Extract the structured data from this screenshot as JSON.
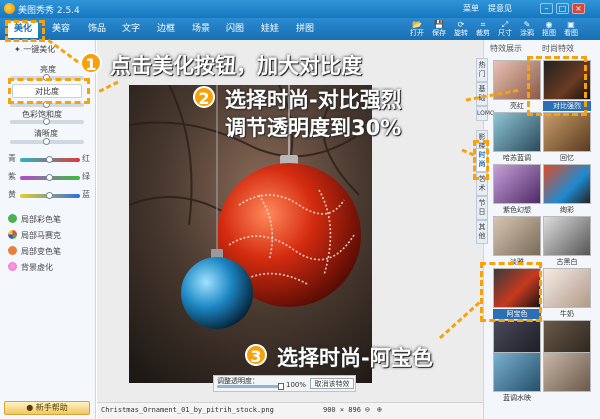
{
  "app": {
    "title": "美图秀秀 2.5.4"
  },
  "titlebar": {
    "menu": "菜单",
    "feedback": "提意见"
  },
  "nav": {
    "tabs": [
      "美化",
      "美容",
      "饰品",
      "文字",
      "边框",
      "场景",
      "闪图",
      "娃娃",
      "拼图"
    ],
    "tools": [
      {
        "icon": "open-icon",
        "label": "打开"
      },
      {
        "icon": "save-icon",
        "label": "保存"
      },
      {
        "icon": "rotate-icon",
        "label": "旋转"
      },
      {
        "icon": "crop-icon",
        "label": "裁剪"
      },
      {
        "icon": "size-icon",
        "label": "尺寸"
      },
      {
        "icon": "doodle-icon",
        "label": "涂鸦"
      },
      {
        "icon": "camera-icon",
        "label": "抠图"
      },
      {
        "icon": "view-icon",
        "label": "看图"
      }
    ]
  },
  "left": {
    "one_click": "一键美化",
    "brightness": "亮度",
    "contrast": "对比度",
    "saturation": "色彩饱和度",
    "sharpness": "清晰度",
    "color_rows": [
      {
        "left": "青",
        "right": "红"
      },
      {
        "left": "紫",
        "right": "绿"
      },
      {
        "left": "黄",
        "right": "蓝"
      }
    ],
    "tools": [
      "局部彩色笔",
      "局部马赛克",
      "局部变色笔",
      "背景虚化"
    ],
    "help": "新手帮助"
  },
  "canvas": {
    "opacity_label": "调整透明度：",
    "opacity_value": "100%",
    "cancel_effect": "取消该特效",
    "filename": "Christmas_Ornament_01_by_pitrih_stock.png",
    "dimensions": "900 × 896"
  },
  "right": {
    "header_left": "特效展示",
    "header_right": "时尚特效",
    "vtabs": [
      "热门",
      "基础",
      "LOMO",
      "影楼",
      "时尚",
      "艺术",
      "节日",
      "其他"
    ],
    "thumbs": [
      "亮红",
      "对比强烈",
      "哈苏蓝调",
      "回忆",
      "紫色幻想",
      "绚彩",
      "淡雅",
      "古黑白",
      "阿宝色",
      "牛奶",
      "哥特风",
      "暗调",
      "柔焦",
      "复古",
      "蓝调水映"
    ]
  },
  "annotations": {
    "step1_num": "1",
    "step1_text": "点击美化按钮，加大对比度",
    "step2_num": "2",
    "step2_text_a": "选择时尚-对比强烈",
    "step2_text_b": "调节透明度到30%",
    "step3_num": "3",
    "step3_text": "选择时尚-阿宝色"
  }
}
